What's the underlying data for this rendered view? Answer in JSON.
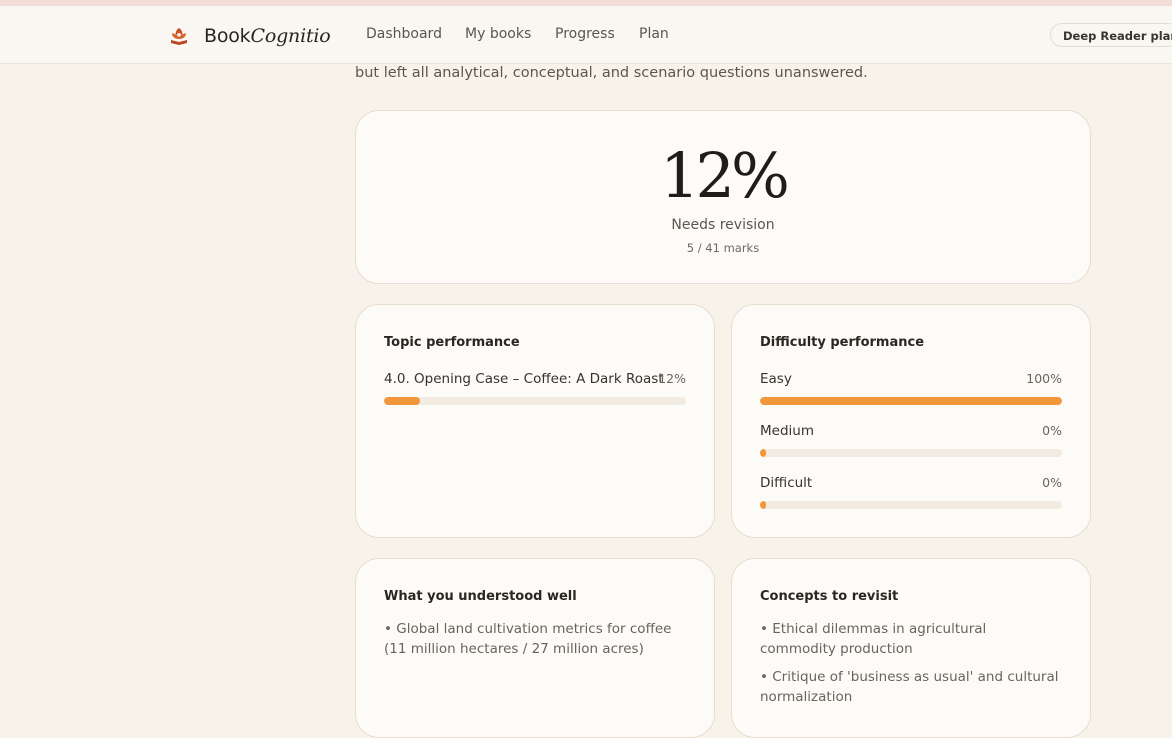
{
  "nav": {
    "brand_book": "Book",
    "brand_cognitio": "Cognitio",
    "links": [
      "Dashboard",
      "My books",
      "Progress",
      "Plan"
    ],
    "plan_button": "Deep Reader plan"
  },
  "lead_text": "but left all analytical, conceptual, and scenario questions unanswered.",
  "score": {
    "value": "12%",
    "label": "Needs revision",
    "marks": "5 / 41 marks"
  },
  "topic": {
    "title": "Topic performance",
    "rows": [
      {
        "label": "4.0. Opening Case – Coffee: A Dark Roast",
        "percent_text": "12%",
        "percent": 12
      }
    ]
  },
  "difficulty": {
    "title": "Difficulty performance",
    "rows": [
      {
        "label": "Easy",
        "percent_text": "100%",
        "percent": 100
      },
      {
        "label": "Medium",
        "percent_text": "0%",
        "percent": 0
      },
      {
        "label": "Difficult",
        "percent_text": "0%",
        "percent": 0
      }
    ]
  },
  "understood": {
    "title": "What you understood well",
    "items": [
      "• Global land cultivation metrics for coffee (11 million hectares / 27 million acres)"
    ]
  },
  "revisit": {
    "title": "Concepts to revisit",
    "items": [
      "• Ethical dilemmas in agricultural commodity production",
      "• Critique of 'business as usual' and cultural normalization"
    ]
  },
  "colors": {
    "accent": "#f2963a",
    "track": "#f1ebe2",
    "background": "#f8f3ea"
  }
}
